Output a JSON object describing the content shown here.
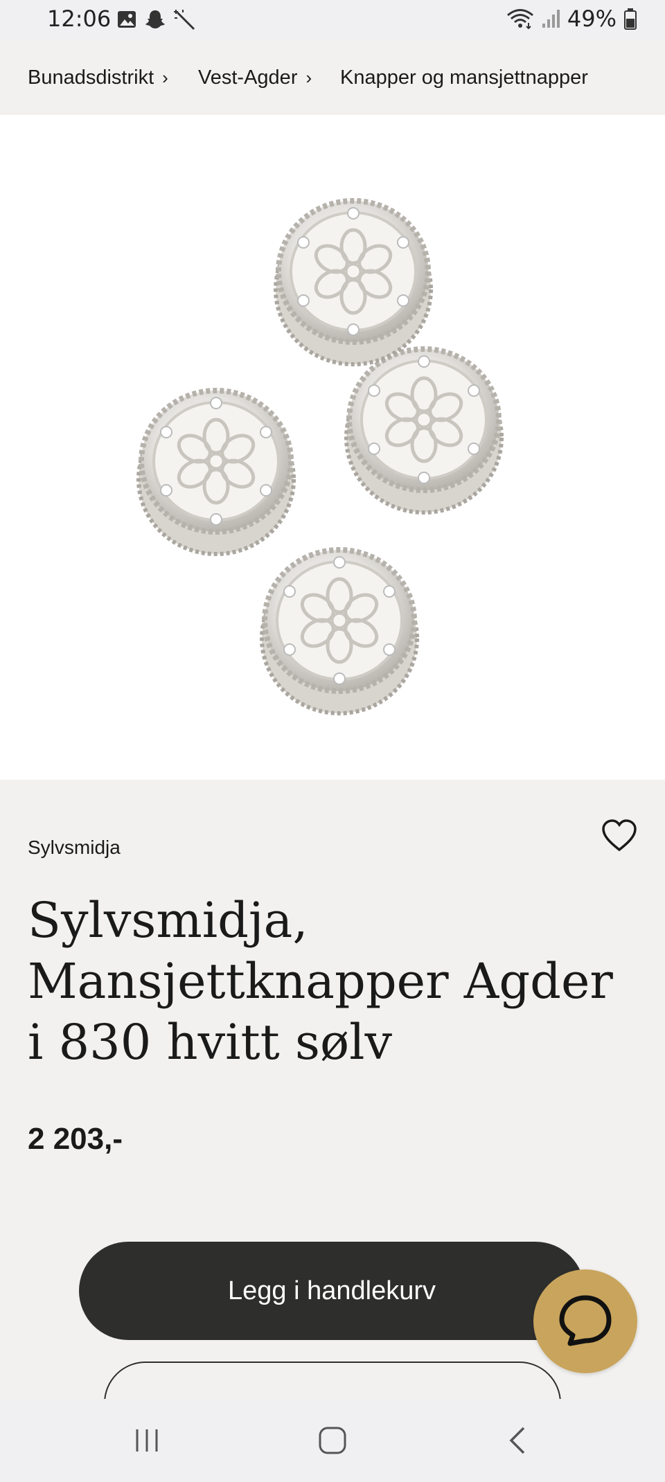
{
  "status_bar": {
    "time": "12:06",
    "battery": "49%"
  },
  "breadcrumb": {
    "items": [
      {
        "label": "Bunadsdistrikt"
      },
      {
        "label": "Vest-Agder"
      },
      {
        "label": "Knapper og mansjettnapper"
      }
    ],
    "separator": "›"
  },
  "product": {
    "brand": "Sylvsmidja",
    "title": "Sylvsmidja, Mansjettknapper Agder i 830 hvitt sølv",
    "price": "2 203,-",
    "add_to_cart_label": "Legg i handlekurv"
  },
  "icons": {
    "wishlist": "heart-outline-icon",
    "chat": "chat-bubble-icon",
    "nav_recent": "recent-apps-icon",
    "nav_home": "home-icon",
    "nav_back": "back-icon"
  },
  "colors": {
    "page_bg": "#f2f1ef",
    "button_bg": "#2e2e2d",
    "chat_fab": "#c9a45c"
  }
}
